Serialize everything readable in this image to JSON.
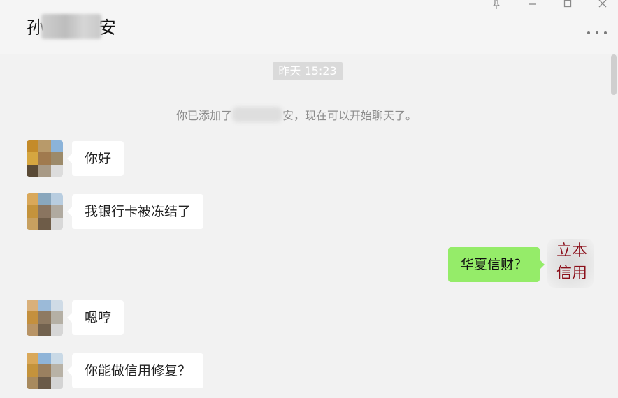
{
  "window": {
    "buttons": [
      {
        "name": "pin-icon",
        "glyph": "⚲"
      },
      {
        "name": "minimize-icon",
        "glyph": "—"
      },
      {
        "name": "maximize-icon",
        "glyph": "▢"
      },
      {
        "name": "close-icon",
        "glyph": "✕"
      }
    ]
  },
  "header": {
    "name_first": "孙",
    "name_last": "安",
    "more_icon": "more-icon"
  },
  "chat": {
    "timestamp": "昨天 15:23",
    "system_note_prefix": "你已添加了",
    "system_note_suffix": "安，现在可以开始聊天了。",
    "messages": [
      {
        "side": "left",
        "text": "你好"
      },
      {
        "side": "left",
        "text": "我银行卡被冻结了"
      },
      {
        "side": "right",
        "text": "华夏信财？"
      },
      {
        "side": "left",
        "text": "嗯哼"
      },
      {
        "side": "left",
        "text": "你能做信用修复？"
      }
    ]
  },
  "stamp": {
    "line1": "立本",
    "line2": "信用"
  },
  "colors": {
    "outgoing_bubble": "#95ec69",
    "incoming_bubble": "#ffffff",
    "stamp_red": "#8b0f1a"
  }
}
